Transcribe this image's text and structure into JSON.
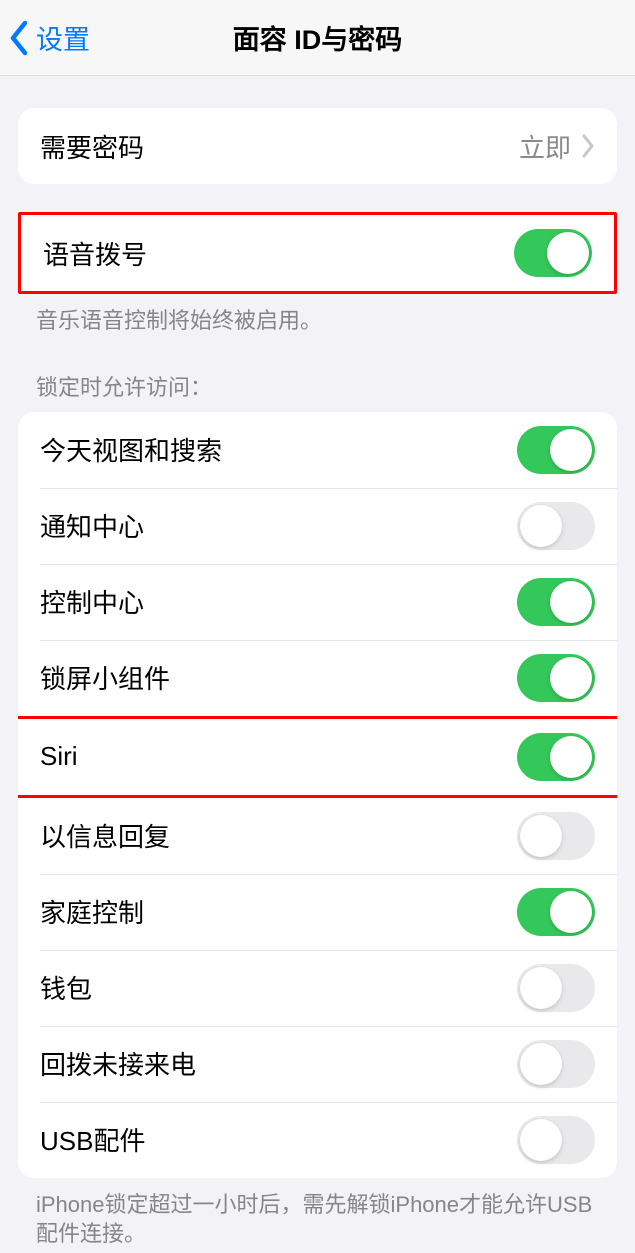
{
  "header": {
    "back_label": "设置",
    "title": "面容 ID与密码"
  },
  "require_passcode": {
    "label": "需要密码",
    "value": "立即"
  },
  "voice_dial": {
    "label": "语音拨号",
    "on": true,
    "footer": "音乐语音控制将始终被启用。"
  },
  "lock_access": {
    "header": "锁定时允许访问：",
    "items": [
      {
        "label": "今天视图和搜索",
        "on": true,
        "highlight": false
      },
      {
        "label": "通知中心",
        "on": false,
        "highlight": false
      },
      {
        "label": "控制中心",
        "on": true,
        "highlight": false
      },
      {
        "label": "锁屏小组件",
        "on": true,
        "highlight": false
      },
      {
        "label": "Siri",
        "on": true,
        "highlight": true
      },
      {
        "label": "以信息回复",
        "on": false,
        "highlight": false
      },
      {
        "label": "家庭控制",
        "on": true,
        "highlight": false
      },
      {
        "label": "钱包",
        "on": false,
        "highlight": false
      },
      {
        "label": "回拨未接来电",
        "on": false,
        "highlight": false
      },
      {
        "label": "USB配件",
        "on": false,
        "highlight": false
      }
    ],
    "footer": "iPhone锁定超过一小时后，需先解锁iPhone才能允许USB配件连接。"
  }
}
